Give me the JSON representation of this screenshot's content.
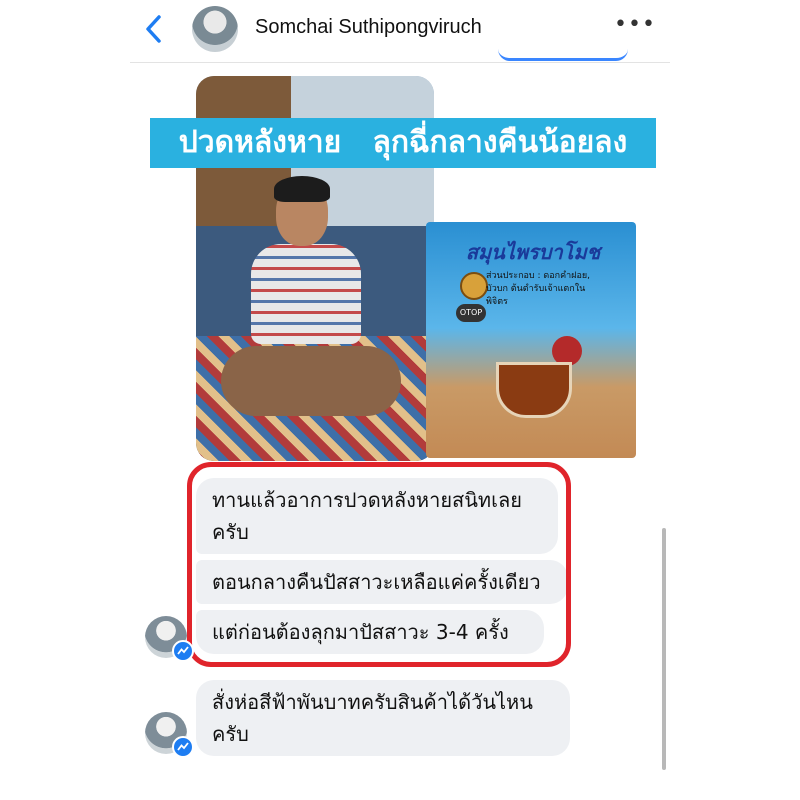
{
  "header": {
    "contact_name": "Somchai Suthipongviruch",
    "back_icon": "chevron-left-icon",
    "more_icon": "more-dots-icon",
    "more_label": "•••"
  },
  "image_post": {
    "banner_text": "ปวดหลังหาย   ลุกฉี่กลางคืนน้อยลง",
    "package_brand": "สมุนไพรบาโมช",
    "package_sub": "ส่วนประกอบ : ดอกคำฝอย, บัวบก\nต้นตำรับเจ้าแตกในพิจิตร",
    "package_otop": "OTOP"
  },
  "messages": [
    {
      "text": "ทานแล้วอาการปวดหลังหายสนิทเลยครับ"
    },
    {
      "text": "ตอนกลางคืนปัสสาวะเหลือแค่ครั้งเดียว"
    },
    {
      "text": "แต่ก่อนต้องลุกมาปัสสาวะ 3-4 ครั้ง"
    },
    {
      "text": "สั่งห่อสีฟ้าพันบาทครับสินค้าได้วันไหนครับ"
    }
  ],
  "colors": {
    "accent": "#1e7df2",
    "highlight_border": "#e0242b",
    "banner_bg": "#2ab1e0",
    "bubble_bg": "#eef0f3"
  }
}
